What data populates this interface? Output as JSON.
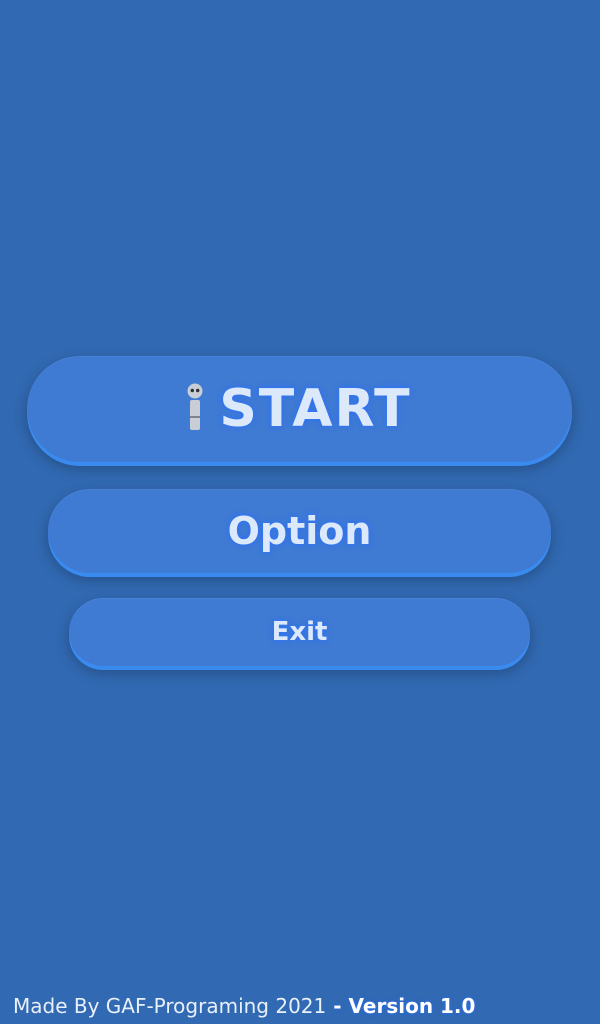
{
  "menu": {
    "start_label": "START",
    "option_label": "Option",
    "exit_label": "Exit",
    "start_icon": "robot-icon"
  },
  "footer": {
    "credit": "Made By GAF-Programing 2021",
    "separator": " - ",
    "version": "Version 1.0"
  },
  "colors": {
    "background": "#3169b2",
    "button": "#3f7ad3",
    "button_glow": "#3a8bf0",
    "label": "#dbe9fb"
  }
}
